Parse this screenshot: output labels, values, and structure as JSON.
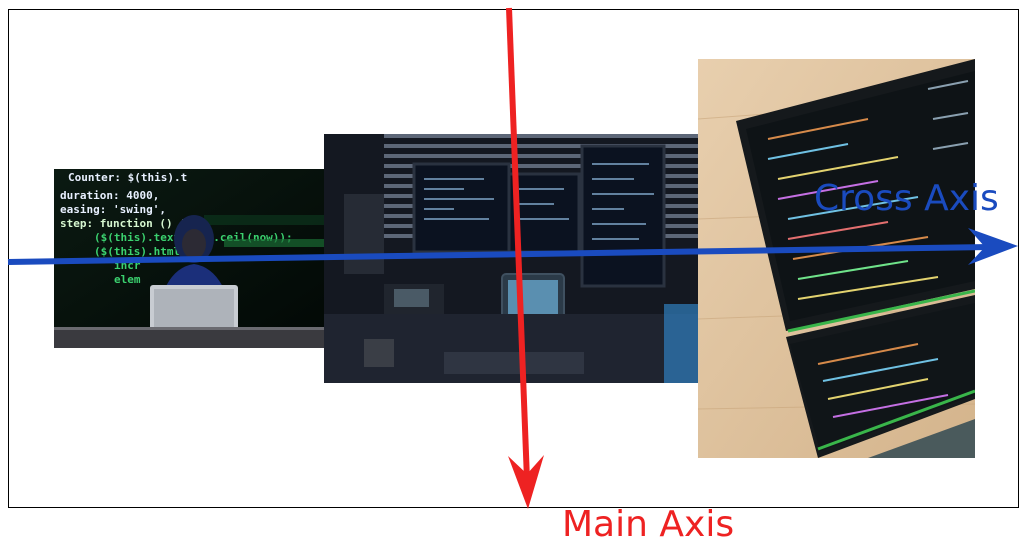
{
  "axes": {
    "cross": {
      "label": "Cross Axis",
      "color": "#1a4bbf"
    },
    "main": {
      "label": "Main Axis",
      "color": "#ee2222"
    }
  },
  "images": [
    {
      "subject": "person in blue hoodie coding on laptop in front of code screen"
    },
    {
      "subject": "desk setup with multiple monitors showing code"
    },
    {
      "subject": "dual-screen laptop showing code on wooden desk"
    }
  ],
  "palette": {
    "frame": "#000000",
    "background": "#ffffff"
  }
}
